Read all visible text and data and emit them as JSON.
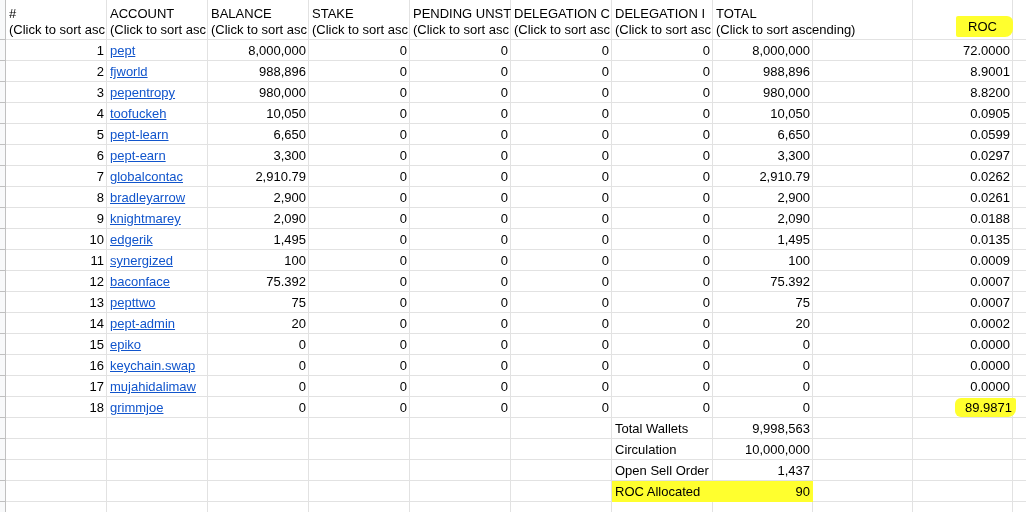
{
  "columns": [
    {
      "title": "#",
      "hint": "(Click to sort asc",
      "highlighted": false
    },
    {
      "title": "ACCOUNT",
      "hint": "(Click to sort asc",
      "highlighted": false
    },
    {
      "title": "BALANCE",
      "hint": "(Click to sort asc",
      "highlighted": false
    },
    {
      "title": "STAKE",
      "hint": "(Click to sort asc",
      "highlighted": false
    },
    {
      "title": "PENDING UNST",
      "hint": "(Click to sort asc",
      "highlighted": false
    },
    {
      "title": "DELEGATION C",
      "hint": "(Click to sort asc",
      "highlighted": false
    },
    {
      "title": "DELEGATION I",
      "hint": "(Click to sort asc",
      "highlighted": false
    },
    {
      "title": "TOTAL",
      "hint": "(Click to sort ascending)",
      "highlighted": false
    },
    {
      "hint": "ROC",
      "highlighted": true
    }
  ],
  "rows": [
    {
      "number": "1",
      "account": "pept",
      "balance": "8,000,000",
      "stake": "0",
      "pending_unstake": "0",
      "delegation_out": "0",
      "delegation_in": "0",
      "total": "8,000,000",
      "roc": "72.0000",
      "highlighted": false
    },
    {
      "number": "2",
      "account": "fjworld",
      "balance": "988,896",
      "stake": "0",
      "pending_unstake": "0",
      "delegation_out": "0",
      "delegation_in": "0",
      "total": "988,896",
      "roc": "8.9001",
      "highlighted": false
    },
    {
      "number": "3",
      "account": "pepentropy",
      "balance": "980,000",
      "stake": "0",
      "pending_unstake": "0",
      "delegation_out": "0",
      "delegation_in": "0",
      "total": "980,000",
      "roc": "8.8200",
      "highlighted": false
    },
    {
      "number": "4",
      "account": "toofuckeh",
      "balance": "10,050",
      "stake": "0",
      "pending_unstake": "0",
      "delegation_out": "0",
      "delegation_in": "0",
      "total": "10,050",
      "roc": "0.0905",
      "highlighted": false
    },
    {
      "number": "5",
      "account": "pept-learn",
      "balance": "6,650",
      "stake": "0",
      "pending_unstake": "0",
      "delegation_out": "0",
      "delegation_in": "0",
      "total": "6,650",
      "roc": "0.0599",
      "highlighted": false
    },
    {
      "number": "6",
      "account": "pept-earn",
      "balance": "3,300",
      "stake": "0",
      "pending_unstake": "0",
      "delegation_out": "0",
      "delegation_in": "0",
      "total": "3,300",
      "roc": "0.0297",
      "highlighted": false
    },
    {
      "number": "7",
      "account": "globalcontac",
      "balance": "2,910.79",
      "stake": "0",
      "pending_unstake": "0",
      "delegation_out": "0",
      "delegation_in": "0",
      "total": "2,910.79",
      "roc": "0.0262",
      "highlighted": false
    },
    {
      "number": "8",
      "account": "bradleyarrow",
      "balance": "2,900",
      "stake": "0",
      "pending_unstake": "0",
      "delegation_out": "0",
      "delegation_in": "0",
      "total": "2,900",
      "roc": "0.0261",
      "highlighted": false
    },
    {
      "number": "9",
      "account": "knightmarey",
      "balance": "2,090",
      "stake": "0",
      "pending_unstake": "0",
      "delegation_out": "0",
      "delegation_in": "0",
      "total": "2,090",
      "roc": "0.0188",
      "highlighted": false
    },
    {
      "number": "10",
      "account": "edgerik",
      "balance": "1,495",
      "stake": "0",
      "pending_unstake": "0",
      "delegation_out": "0",
      "delegation_in": "0",
      "total": "1,495",
      "roc": "0.0135",
      "highlighted": false
    },
    {
      "number": "11",
      "account": "synergized",
      "balance": "100",
      "stake": "0",
      "pending_unstake": "0",
      "delegation_out": "0",
      "delegation_in": "0",
      "total": "100",
      "roc": "0.0009",
      "highlighted": false
    },
    {
      "number": "12",
      "account": "baconface",
      "balance": "75.392",
      "stake": "0",
      "pending_unstake": "0",
      "delegation_out": "0",
      "delegation_in": "0",
      "total": "75.392",
      "roc": "0.0007",
      "highlighted": false
    },
    {
      "number": "13",
      "account": "pepttwo",
      "balance": "75",
      "stake": "0",
      "pending_unstake": "0",
      "delegation_out": "0",
      "delegation_in": "0",
      "total": "75",
      "roc": "0.0007",
      "highlighted": false
    },
    {
      "number": "14",
      "account": "pept-admin",
      "balance": "20",
      "stake": "0",
      "pending_unstake": "0",
      "delegation_out": "0",
      "delegation_in": "0",
      "total": "20",
      "roc": "0.0002",
      "highlighted": false
    },
    {
      "number": "15",
      "account": "epiko",
      "balance": "0",
      "stake": "0",
      "pending_unstake": "0",
      "delegation_out": "0",
      "delegation_in": "0",
      "total": "0",
      "roc": "0.0000",
      "highlighted": false
    },
    {
      "number": "16",
      "account": "keychain.swap",
      "balance": "0",
      "stake": "0",
      "pending_unstake": "0",
      "delegation_out": "0",
      "delegation_in": "0",
      "total": "0",
      "roc": "0.0000",
      "highlighted": false
    },
    {
      "number": "17",
      "account": "mujahidalimaw",
      "balance": "0",
      "stake": "0",
      "pending_unstake": "0",
      "delegation_out": "0",
      "delegation_in": "0",
      "total": "0",
      "roc": "0.0000",
      "highlighted": false
    },
    {
      "number": "18",
      "account": "grimmjoe",
      "balance": "0",
      "stake": "0",
      "pending_unstake": "0",
      "delegation_out": "0",
      "delegation_in": "0",
      "total": "0",
      "roc": "89.9871",
      "highlighted": true
    }
  ],
  "summary": [
    {
      "label": "Total Wallets",
      "value": "9,998,563",
      "highlighted": false
    },
    {
      "label": "Circulation",
      "value": "10,000,000",
      "highlighted": false
    },
    {
      "label": "Open Sell Order",
      "value": "1,437",
      "highlighted": false
    },
    {
      "label": "ROC Allocated",
      "value": "90",
      "highlighted": true
    }
  ]
}
